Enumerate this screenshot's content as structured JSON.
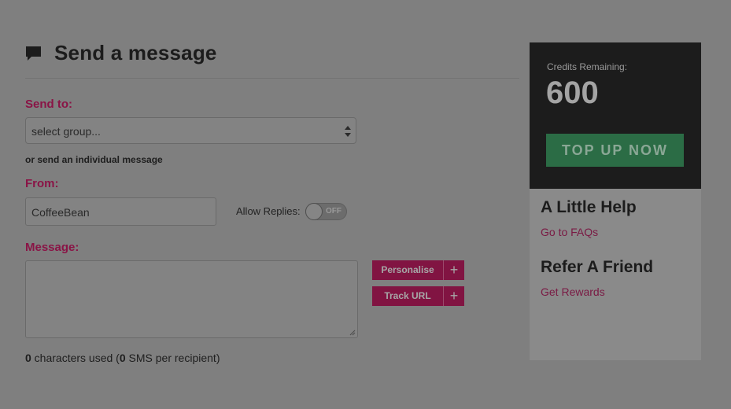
{
  "header": {
    "title": "Send a message",
    "icon": "speech-bubble-icon"
  },
  "send_to": {
    "label": "Send to:",
    "select_value": "select group...",
    "individual_link": "or send an individual message"
  },
  "from": {
    "label": "From:",
    "value": "CoffeeBean",
    "allow_replies_label": "Allow Replies:",
    "toggle_state": "OFF"
  },
  "message": {
    "label": "Message:",
    "value": "",
    "personalise_label": "Personalise",
    "track_url_label": "Track URL",
    "plus": "+",
    "chars_count": "0",
    "chars_text_1": " characters used (",
    "sms_count": "0",
    "chars_text_2": " SMS per recipient)"
  },
  "credits": {
    "label": "Credits Remaining:",
    "value": "600",
    "top_up_label": "TOP UP NOW"
  },
  "help": {
    "title": "A Little Help",
    "faq_link": "Go to FAQs",
    "refer_title": "Refer A Friend",
    "rewards_link": "Get Rewards"
  },
  "colors": {
    "accent": "#811442",
    "credits_bg": "#1c1c1c",
    "topup": "#2b6c45"
  }
}
